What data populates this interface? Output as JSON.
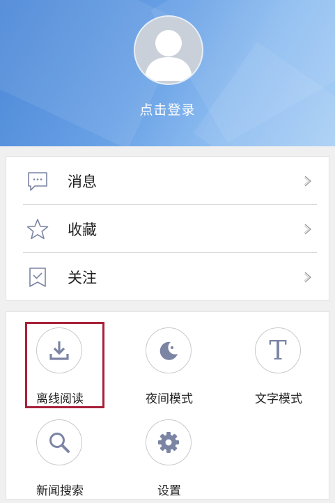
{
  "header": {
    "login_label": "点击登录",
    "avatar_icon": "user-avatar-icon"
  },
  "menu": {
    "items": [
      {
        "label": "消息",
        "icon": "message-icon"
      },
      {
        "label": "收藏",
        "icon": "star-icon"
      },
      {
        "label": "关注",
        "icon": "bookmark-check-icon"
      }
    ]
  },
  "tools": {
    "items": [
      {
        "label": "离线阅读",
        "icon": "download-icon",
        "highlighted": true
      },
      {
        "label": "夜间模式",
        "icon": "moon-icon"
      },
      {
        "label": "文字模式",
        "icon": "text-t-icon"
      },
      {
        "label": "新闻搜索",
        "icon": "search-icon"
      },
      {
        "label": "设置",
        "icon": "gear-icon"
      }
    ]
  },
  "colors": {
    "header_start": "#4a86d6",
    "header_end": "#a9cff5",
    "icon_gray": "#7b84a3",
    "highlight": "#a8203a"
  }
}
